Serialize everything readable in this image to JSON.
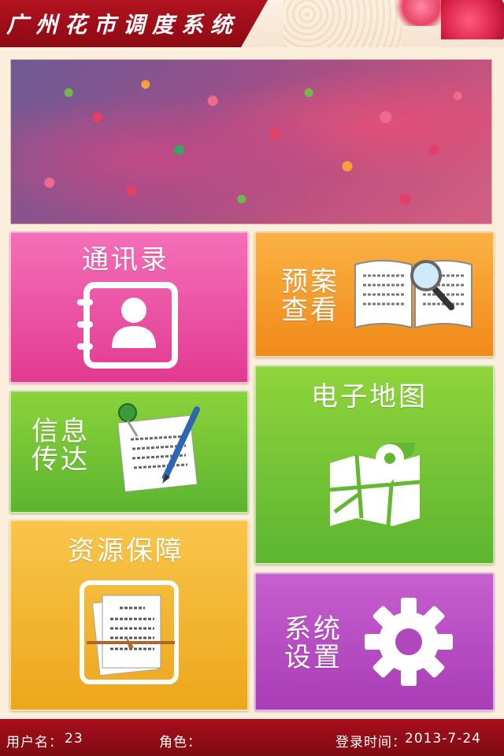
{
  "header": {
    "title": "广州花市调度系统"
  },
  "tiles": {
    "contacts": {
      "label": "通讯录",
      "icon": "address-book-icon",
      "color": "#e23a92"
    },
    "plan": {
      "label_line1": "预案",
      "label_line2": "查看",
      "icon": "book-magnifier-icon",
      "color": "#f0891a"
    },
    "message": {
      "label_line1": "信息",
      "label_line2": "传达",
      "icon": "pinned-note-pen-icon",
      "color": "#5cb530"
    },
    "map": {
      "label": "电子地图",
      "icon": "map-pin-icon",
      "color": "#5db531"
    },
    "resources": {
      "label": "资源保障",
      "icon": "documents-bundle-icon",
      "color": "#eda71c"
    },
    "settings": {
      "label_line1": "系统",
      "label_line2": "设置",
      "icon": "gear-icon",
      "color": "#a93cb6"
    }
  },
  "footer": {
    "username_label": "用户名：",
    "username_value": "23",
    "role_label": "角色：",
    "role_value": "",
    "login_time_label": "登录时间：",
    "login_time_value": "2013-7-24"
  },
  "colors": {
    "header_red": "#a80f1c",
    "background": "#fbeedd"
  }
}
